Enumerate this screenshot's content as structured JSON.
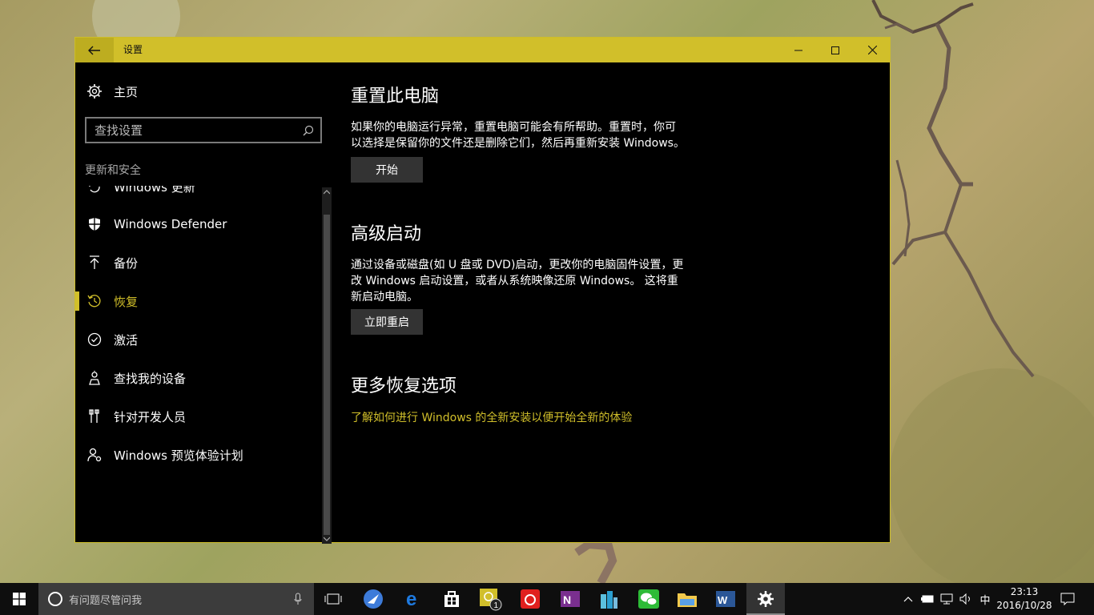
{
  "window": {
    "title": "设置"
  },
  "sidebar": {
    "home_label": "主页",
    "search_placeholder": "查找设置",
    "section_label": "更新和安全",
    "items": [
      {
        "label": "Windows 更新",
        "icon": "sync-icon"
      },
      {
        "label": "Windows Defender",
        "icon": "shield-icon"
      },
      {
        "label": "备份",
        "icon": "upload-arrow-icon"
      },
      {
        "label": "恢复",
        "icon": "history-icon",
        "selected": true
      },
      {
        "label": "激活",
        "icon": "check-circle-icon"
      },
      {
        "label": "查找我的设备",
        "icon": "person-location-icon"
      },
      {
        "label": "针对开发人员",
        "icon": "developer-tools-icon"
      },
      {
        "label": "Windows 预览体验计划",
        "icon": "person-settings-icon"
      }
    ]
  },
  "content": {
    "reset": {
      "title": "重置此电脑",
      "description_line1": "如果你的电脑运行异常，重置电脑可能会有所帮助。重置时，你可",
      "description_line2": "以选择是保留你的文件还是删除它们，然后再重新安装 Windows。",
      "button": "开始"
    },
    "advanced": {
      "title": "高级启动",
      "description_line1": "通过设备或磁盘(如 U 盘或 DVD)启动，更改你的电脑固件设置，更",
      "description_line2": "改 Windows 启动设置，或者从系统映像还原 Windows。 这将重",
      "description_line3": "新启动电脑。",
      "button": "立即重启"
    },
    "more": {
      "title": "更多恢复选项",
      "link": "了解如何进行 Windows 的全新安装以便开始全新的体验"
    }
  },
  "taskbar": {
    "search_placeholder": "有问题尽管问我",
    "apps": [
      {
        "name": "task-view-icon"
      },
      {
        "name": "feather-browser-icon"
      },
      {
        "name": "edge-icon"
      },
      {
        "name": "store-icon"
      },
      {
        "name": "qq-icon",
        "badge": "1"
      },
      {
        "name": "netease-music-icon"
      },
      {
        "name": "onenote-icon"
      },
      {
        "name": "city-app-icon"
      },
      {
        "name": "wechat-icon"
      },
      {
        "name": "file-explorer-icon"
      },
      {
        "name": "word-icon"
      },
      {
        "name": "settings-icon",
        "active": true
      }
    ],
    "ime": "中",
    "time": "23:13",
    "date": "2016/10/28"
  },
  "colors": {
    "accent": "#d1bf2a",
    "window_bg": "#000000",
    "button_bg": "#333333"
  }
}
